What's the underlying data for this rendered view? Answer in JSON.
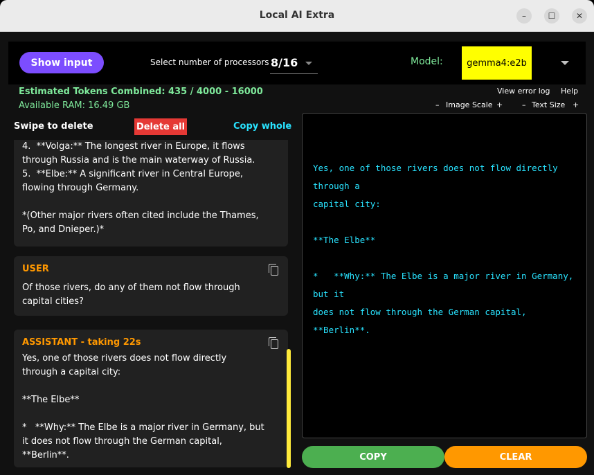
{
  "window": {
    "title": "Local AI Extra",
    "minimize": "–",
    "maximize": "☐",
    "close": "✕"
  },
  "toolbar": {
    "show_input": "Show input",
    "processors_label": "Select number of processors",
    "processors_value": "8/16",
    "model_label": "Model:",
    "model_value": "gemma4:e2b"
  },
  "status": {
    "tokens": "Estimated Tokens Combined: 435 / 4000 - 16000",
    "ram": "Available RAM: 16.49 GB",
    "view_error_log": "View error log",
    "help": "Help",
    "image_scale": {
      "minus": "–",
      "label": "Image Scale",
      "plus": "+"
    },
    "text_size": {
      "minus": "–",
      "label": "Text Size",
      "plus": "+"
    }
  },
  "chat_actions": {
    "swipe_to_delete": "Swipe to delete",
    "delete_all": "Delete all",
    "copy_whole": "Copy whole"
  },
  "messages": [
    {
      "role": "",
      "text": "4.  **Volga:** The longest river in Europe, it flows\nthrough Russia and is the main waterway of Russia.\n5.  **Elbe:** A significant river in Central Europe,\nflowing through Germany.\n\n*(Other major rivers often cited include the Thames,\nPo, and Dnieper.)*"
    },
    {
      "role": "USER",
      "text": "Of those rivers, do any of them not flow through\ncapital cities?"
    },
    {
      "role": "ASSISTANT  - taking 22s",
      "text": "Yes, one of those rivers does not flow directly\nthrough a capital city:\n\n**The Elbe**\n\n*   **Why:** The Elbe is a major river in Germany, but\nit does not flow through the German capital,\n**Berlin**."
    }
  ],
  "output_text": "Yes, one of those rivers does not flow directly through a\ncapital city:\n\n**The Elbe**\n\n*   **Why:** The Elbe is a major river in Germany, but it\ndoes not flow through the German capital, **Berlin**.",
  "buttons": {
    "copy": "COPY",
    "clear": "CLEAR"
  },
  "colors": {
    "accent_purple": "#7c4dff",
    "model_highlight": "#ffff00",
    "status_green": "#7ee89a",
    "cyan_text": "#29e3ff",
    "role_orange": "#ff9800",
    "delete_red": "#e53935",
    "copy_green": "#4caf50",
    "clear_orange": "#ff9800",
    "scrollbar_yellow": "#ffeb3b"
  }
}
